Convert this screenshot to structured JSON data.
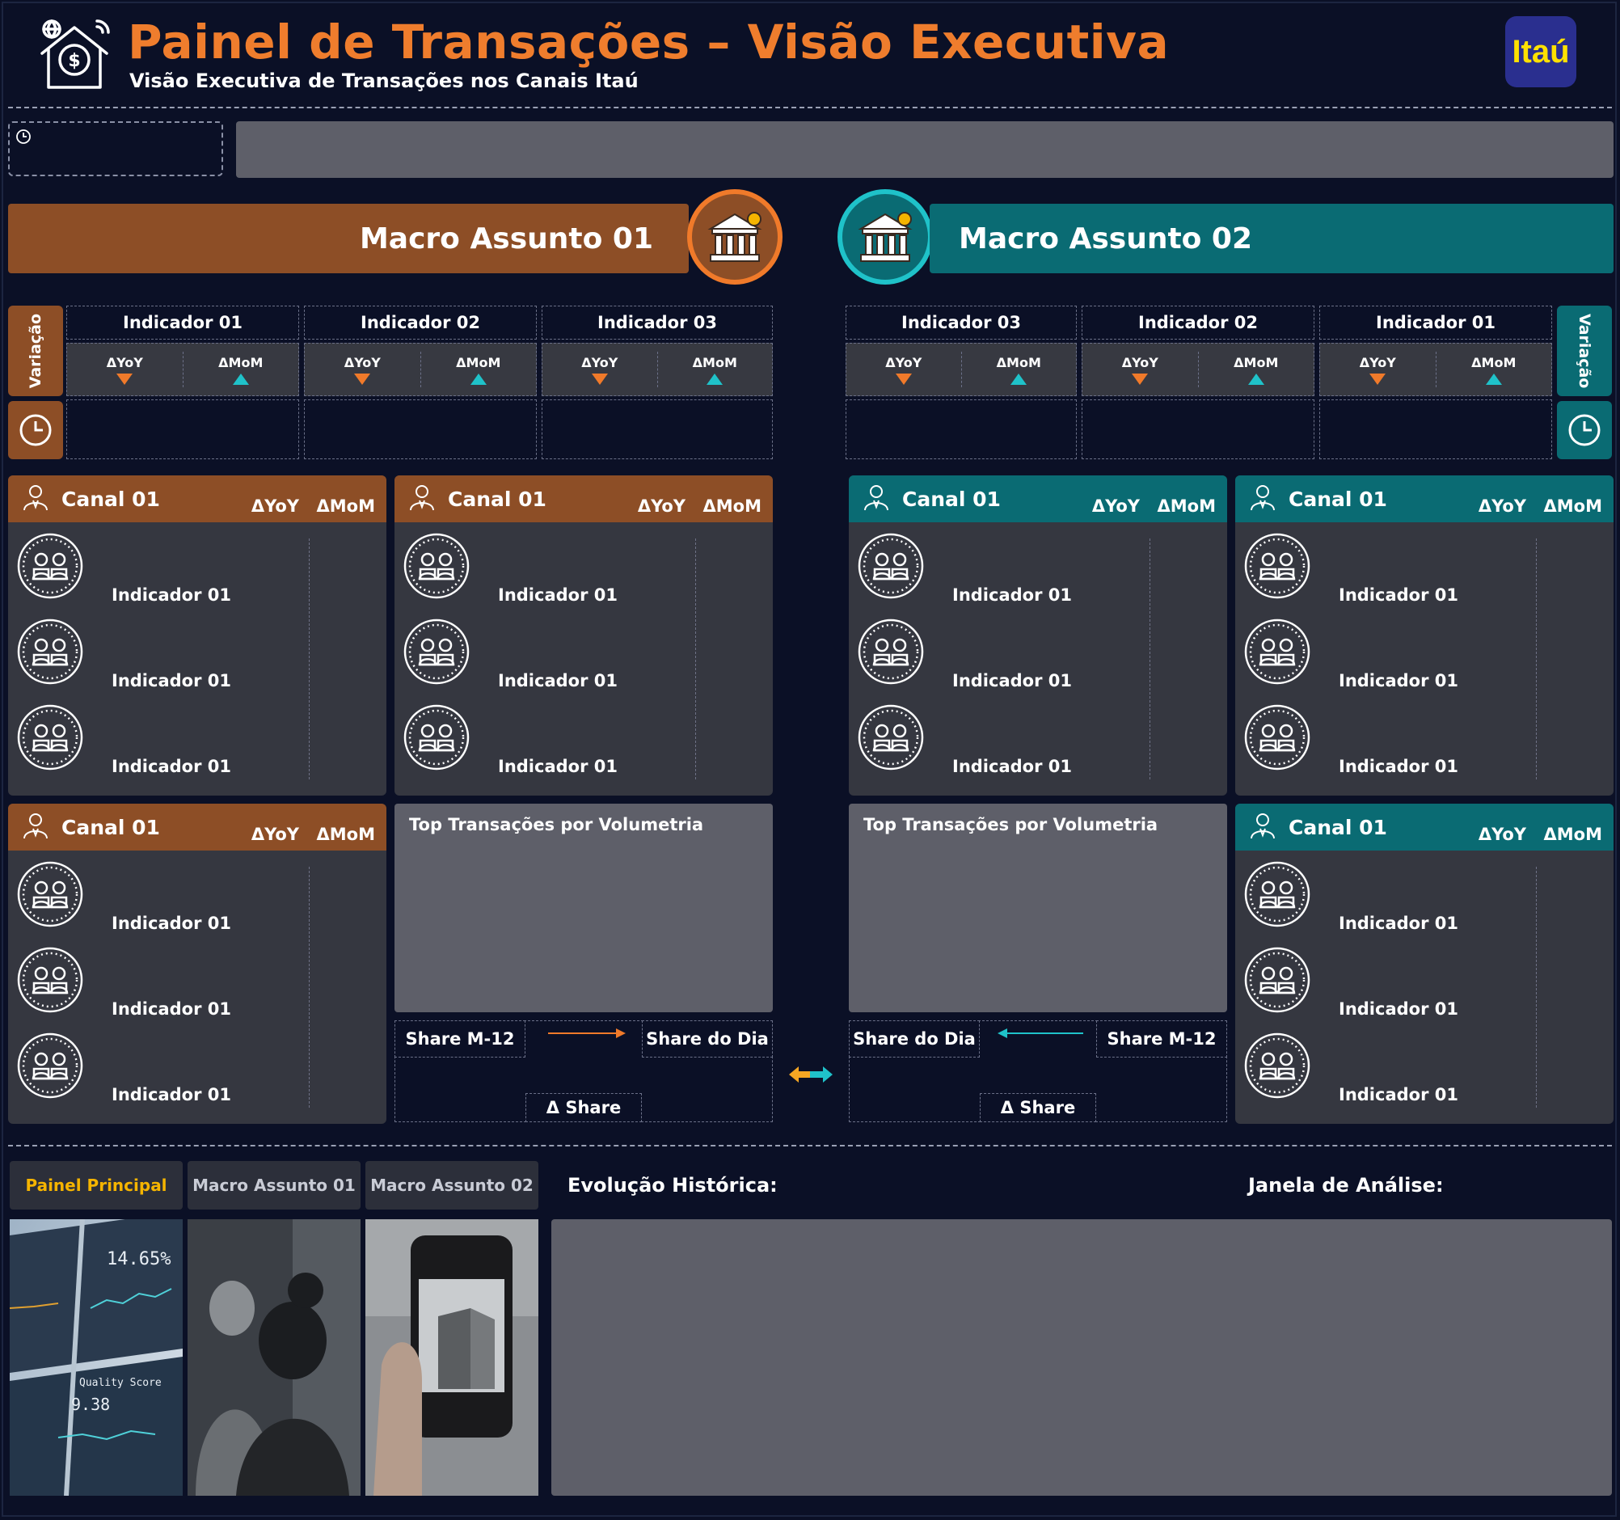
{
  "header": {
    "title": "Painel de Transações – Visão Executiva",
    "subtitle": "Visão Executiva de Transações nos Canais Itaú",
    "logo_text": "Itaú",
    "header_icon": "house-dollar-icon",
    "logo_bg": "#2a2f8f",
    "logo_fg": "#ffe100"
  },
  "colors": {
    "background": "#0b1026",
    "orange_accent": "#ef7d2d",
    "orange_panel": "#8d4e26",
    "teal_panel": "#0a6b73",
    "teal_accent": "#1fc2c9",
    "card_bg": "#353740",
    "placeholder_gray": "#5e5f69",
    "nav_active": "#f5b400"
  },
  "macro1": {
    "title": "Macro Assunto 01",
    "variacao": "Variação",
    "indicators": [
      {
        "name": "Indicador 01",
        "yoy": "ΔYoY",
        "mom": "ΔMoM"
      },
      {
        "name": "Indicador 02",
        "yoy": "ΔYoY",
        "mom": "ΔMoM"
      },
      {
        "name": "Indicador 03",
        "yoy": "ΔYoY",
        "mom": "ΔMoM"
      }
    ],
    "canais": [
      {
        "title": "Canal 01",
        "yoy": "ΔYoY",
        "mom": "ΔMoM",
        "rows": [
          "Indicador 01",
          "Indicador 01",
          "Indicador 01"
        ]
      },
      {
        "title": "Canal 01",
        "yoy": "ΔYoY",
        "mom": "ΔMoM",
        "rows": [
          "Indicador 01",
          "Indicador 01",
          "Indicador 01"
        ]
      },
      {
        "title": "Canal 01",
        "yoy": "ΔYoY",
        "mom": "ΔMoM",
        "rows": [
          "Indicador 01",
          "Indicador 01",
          "Indicador 01"
        ]
      }
    ],
    "top": {
      "title": "Top Transações por Volumetria",
      "share_left": "Share M-12",
      "share_right": "Share do Dia",
      "delta_share": "Δ Share"
    }
  },
  "macro2": {
    "title": "Macro Assunto 02",
    "variacao": "Variação",
    "indicators": [
      {
        "name": "Indicador 03",
        "yoy": "ΔYoY",
        "mom": "ΔMoM"
      },
      {
        "name": "Indicador 02",
        "yoy": "ΔYoY",
        "mom": "ΔMoM"
      },
      {
        "name": "Indicador 01",
        "yoy": "ΔYoY",
        "mom": "ΔMoM"
      }
    ],
    "canais": [
      {
        "title": "Canal 01",
        "yoy": "ΔYoY",
        "mom": "ΔMoM",
        "rows": [
          "Indicador 01",
          "Indicador 01",
          "Indicador 01"
        ]
      },
      {
        "title": "Canal 01",
        "yoy": "ΔYoY",
        "mom": "ΔMoM",
        "rows": [
          "Indicador 01",
          "Indicador 01",
          "Indicador 01"
        ]
      },
      {
        "title": "Canal 01",
        "yoy": "ΔYoY",
        "mom": "ΔMoM",
        "rows": [
          "Indicador 01",
          "Indicador 01",
          "Indicador 01"
        ]
      }
    ],
    "top": {
      "title": "Top Transações por Volumetria",
      "share_left": "Share do Dia",
      "share_right": "Share M-12",
      "delta_share": "Δ Share"
    }
  },
  "nav": {
    "tabs": [
      "Painel Principal",
      "Macro Assunto 01",
      "Macro Assunto 02"
    ],
    "active": "Painel Principal"
  },
  "bottom": {
    "evolucao": "Evolução Histórica:",
    "janela": "Janela de Análise:"
  },
  "photos": [
    {
      "name": "dashboard-photo",
      "texts": [
        "14.65%",
        "Quality Score",
        "9.38"
      ]
    },
    {
      "name": "people-photo"
    },
    {
      "name": "phone-photo"
    }
  ]
}
